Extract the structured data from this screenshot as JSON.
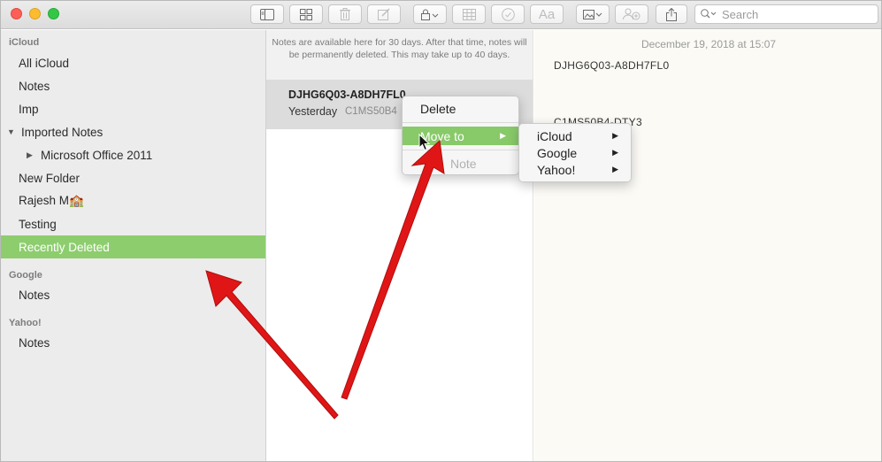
{
  "toolbar": {
    "search_placeholder": "Search",
    "format_label": "Aa"
  },
  "sidebar": {
    "sections": [
      {
        "header": "iCloud"
      },
      {
        "header": "Google"
      },
      {
        "header": "Yahoo!"
      }
    ],
    "icloud_items": [
      {
        "label": "All iCloud"
      },
      {
        "label": "Notes"
      },
      {
        "label": "Imp"
      },
      {
        "label": "Imported Notes"
      },
      {
        "label": "Microsoft Office 2011"
      },
      {
        "label": "New Folder"
      },
      {
        "label": "Rajesh M🏫"
      },
      {
        "label": "Testing"
      },
      {
        "label": "Recently Deleted"
      }
    ],
    "google_items": [
      {
        "label": "Notes"
      }
    ],
    "yahoo_items": [
      {
        "label": "Notes"
      }
    ]
  },
  "notelist": {
    "notice": "Notes are available here for 30 days. After that time, notes will be permanently deleted. This may take up to 40 days.",
    "note": {
      "title": "DJHG6Q03-A8DH7FL0",
      "date": "Yesterday",
      "snippet": "C1MS50B4"
    }
  },
  "editor": {
    "date": "December 19, 2018 at 15:07",
    "line1": "DJHG6Q03-A8DH7FL0",
    "line2": "C1MS50B4-DTY3"
  },
  "context_menu": {
    "items": [
      {
        "label": "Delete"
      },
      {
        "label": "Move to"
      },
      {
        "label": "Note"
      }
    ],
    "submenu": [
      {
        "label": "iCloud"
      },
      {
        "label": "Google"
      },
      {
        "label": "Yahoo!"
      }
    ]
  },
  "colors": {
    "selection": "#8dcd6e",
    "arrow": "#e01616"
  },
  "icons": [
    "sidebar-toggle-icon",
    "gallery-icon",
    "trash-icon",
    "compose-icon",
    "lock-icon",
    "table-icon",
    "checklist-icon",
    "media-icon",
    "add-people-icon",
    "share-icon",
    "search-icon"
  ]
}
